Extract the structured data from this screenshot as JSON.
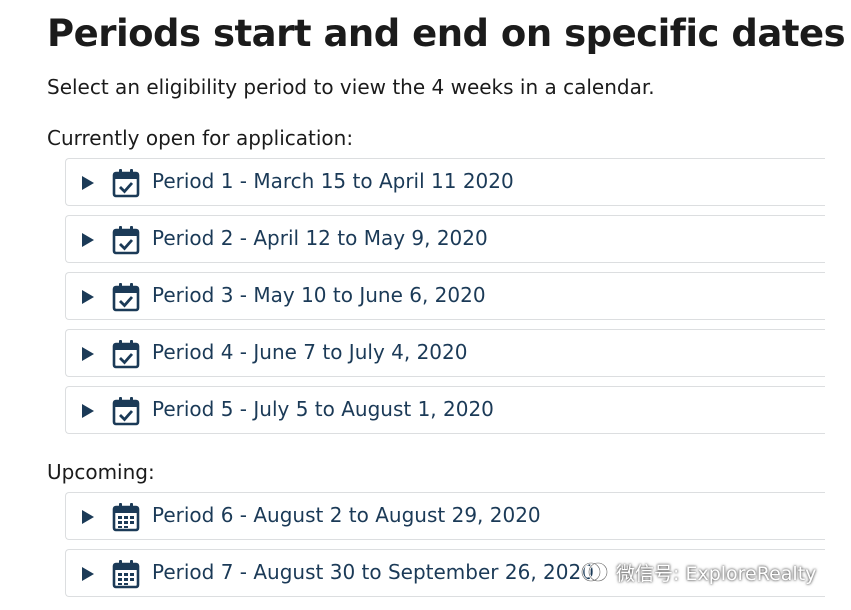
{
  "page": {
    "title": "Periods start and end on specific dates",
    "subtitle": "Select an eligibility period to view the 4 weeks in a calendar."
  },
  "sections": {
    "open": {
      "label": "Currently open for application:",
      "icon": "calendar-check-icon",
      "items": [
        {
          "label": "Period 1 - March 15 to April 11 2020"
        },
        {
          "label": "Period 2 - April 12 to May 9, 2020"
        },
        {
          "label": "Period 3 - May 10 to June 6, 2020"
        },
        {
          "label": "Period 4 - June 7 to July 4, 2020"
        },
        {
          "label": "Period 5 - July 5 to August 1, 2020"
        }
      ]
    },
    "upcoming": {
      "label": "Upcoming:",
      "icon": "calendar-grid-icon",
      "items": [
        {
          "label": "Period 6 - August 2 to August 29, 2020"
        },
        {
          "label": "Period 7 - August 30 to September 26, 2020"
        }
      ]
    }
  },
  "watermark": {
    "text": "微信号: ExploreRealty",
    "icon": "wechat-logo-icon"
  },
  "colors": {
    "text": "#1b1b1b",
    "accent": "#1b3a57",
    "border": "#dcdee0"
  }
}
